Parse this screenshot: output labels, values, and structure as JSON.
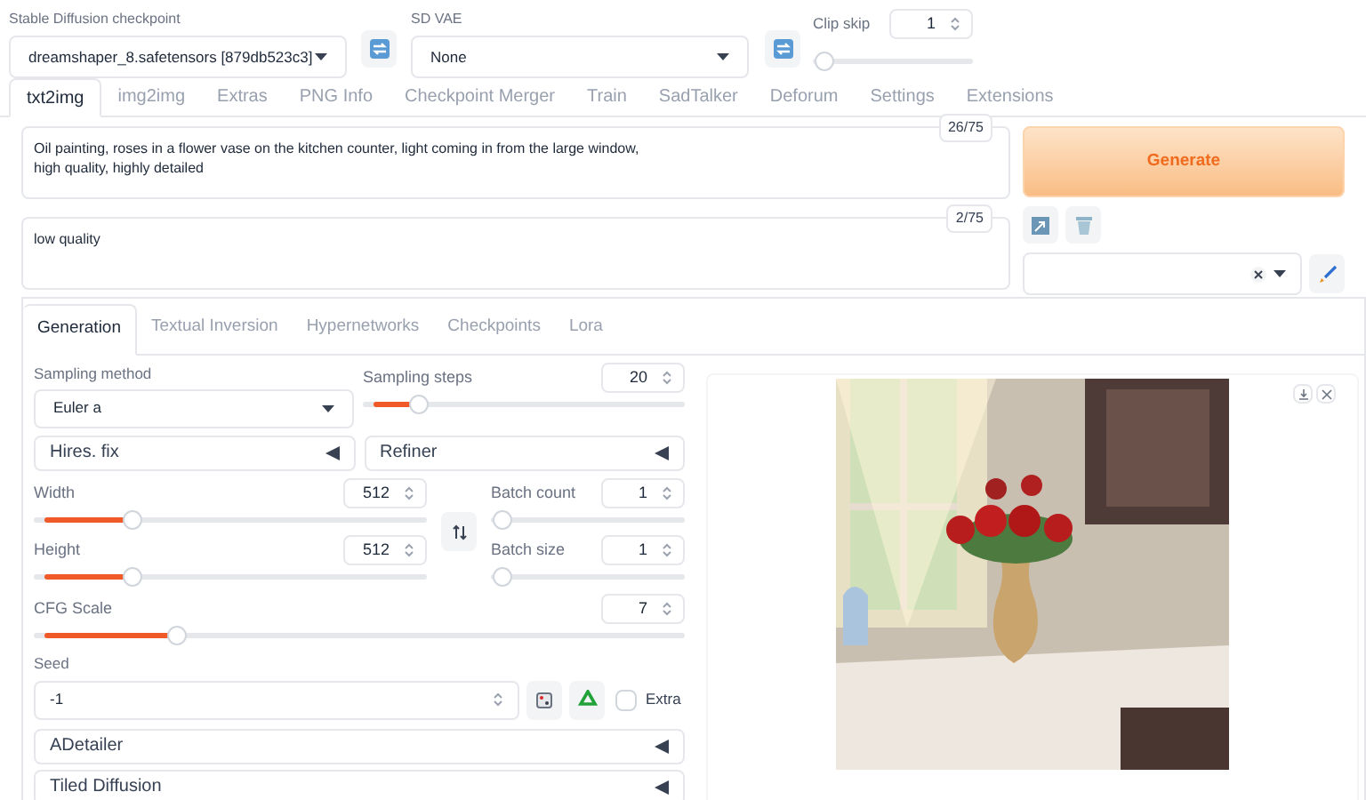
{
  "checkpoint": {
    "label": "Stable Diffusion checkpoint",
    "value": "dreamshaper_8.safetensors [879db523c3]"
  },
  "vae": {
    "label": "SD VAE",
    "value": "None"
  },
  "clip_skip": {
    "label": "Clip skip",
    "value": "1",
    "level": 0
  },
  "tabs": [
    {
      "label": "txt2img",
      "selected": true
    },
    {
      "label": "img2img",
      "selected": false
    },
    {
      "label": "Extras",
      "selected": false
    },
    {
      "label": "PNG Info",
      "selected": false
    },
    {
      "label": "Checkpoint Merger",
      "selected": false
    },
    {
      "label": "Train",
      "selected": false
    },
    {
      "label": "SadTalker",
      "selected": false
    },
    {
      "label": "Deforum",
      "selected": false
    },
    {
      "label": "Settings",
      "selected": false
    },
    {
      "label": "Extensions",
      "selected": false
    }
  ],
  "prompt": {
    "value": "Oil painting, roses in a flower vase on the kitchen counter, light coming in from the large window,\nhigh quality, highly detailed",
    "token_count": "26/75"
  },
  "negative_prompt": {
    "value": "low quality",
    "token_count": "2/75"
  },
  "generate_button": "Generate",
  "subtabs": [
    {
      "label": "Generation",
      "selected": true
    },
    {
      "label": "Textual Inversion",
      "selected": false
    },
    {
      "label": "Hypernetworks",
      "selected": false
    },
    {
      "label": "Checkpoints",
      "selected": false
    },
    {
      "label": "Lora",
      "selected": false
    }
  ],
  "sampling_method": {
    "label": "Sampling method",
    "value": "Euler a"
  },
  "sampling_steps": {
    "label": "Sampling steps",
    "value": "20",
    "level": 0.15
  },
  "mid_accordions": [
    {
      "label": "Hires. fix",
      "expanded": false
    },
    {
      "label": "Refiner",
      "expanded": false
    }
  ],
  "width": {
    "label": "Width",
    "value": "512",
    "level": 0.235
  },
  "height": {
    "label": "Height",
    "value": "512",
    "level": 0.235
  },
  "batch_count": {
    "label": "Batch count",
    "value": "1",
    "level": 0
  },
  "batch_size": {
    "label": "Batch size",
    "value": "1",
    "level": 0
  },
  "cfg_scale": {
    "label": "CFG Scale",
    "value": "7",
    "level": 0.21
  },
  "seed": {
    "label": "Seed",
    "value": "-1"
  },
  "extra": {
    "label": "Extra",
    "checked": false
  },
  "bottom_accordions": [
    {
      "label": "ADetailer",
      "expanded": false
    },
    {
      "label": "Tiled Diffusion",
      "expanded": false
    }
  ]
}
